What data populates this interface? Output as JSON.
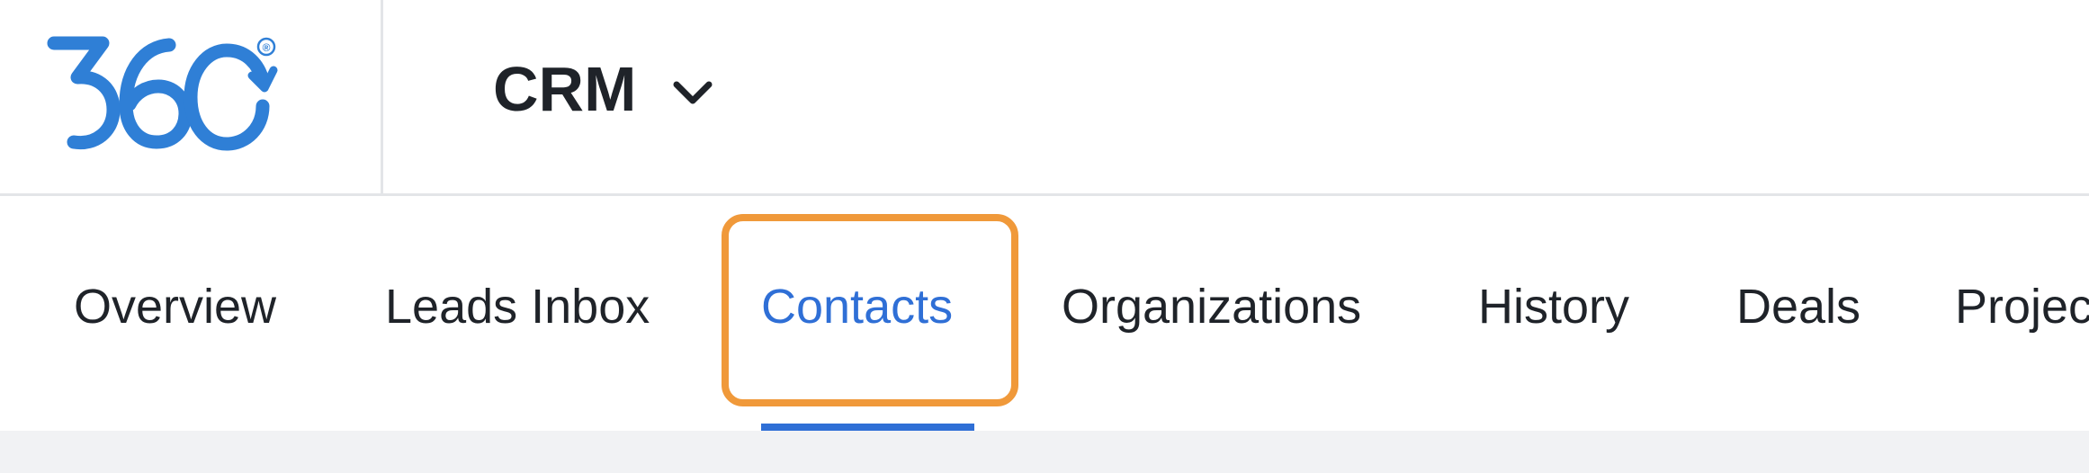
{
  "brand": {
    "logo_text": "360",
    "registered_mark": "®",
    "logo_color": "#2f7fd6"
  },
  "header": {
    "app_name": "CRM",
    "dropdown_icon": "chevron-down-icon"
  },
  "tabs": [
    {
      "label": "Overview",
      "active": false
    },
    {
      "label": "Leads Inbox",
      "active": false
    },
    {
      "label": "Contacts",
      "active": true
    },
    {
      "label": "Organizations",
      "active": false
    },
    {
      "label": "History",
      "active": false
    },
    {
      "label": "Deals",
      "active": false
    },
    {
      "label": "Projects",
      "active": false
    }
  ],
  "colors": {
    "active_tab": "#2f6fd6",
    "text": "#1f2329",
    "highlight": "#f0993a",
    "divider": "#e3e5e8",
    "content_bg": "#f1f2f4"
  }
}
